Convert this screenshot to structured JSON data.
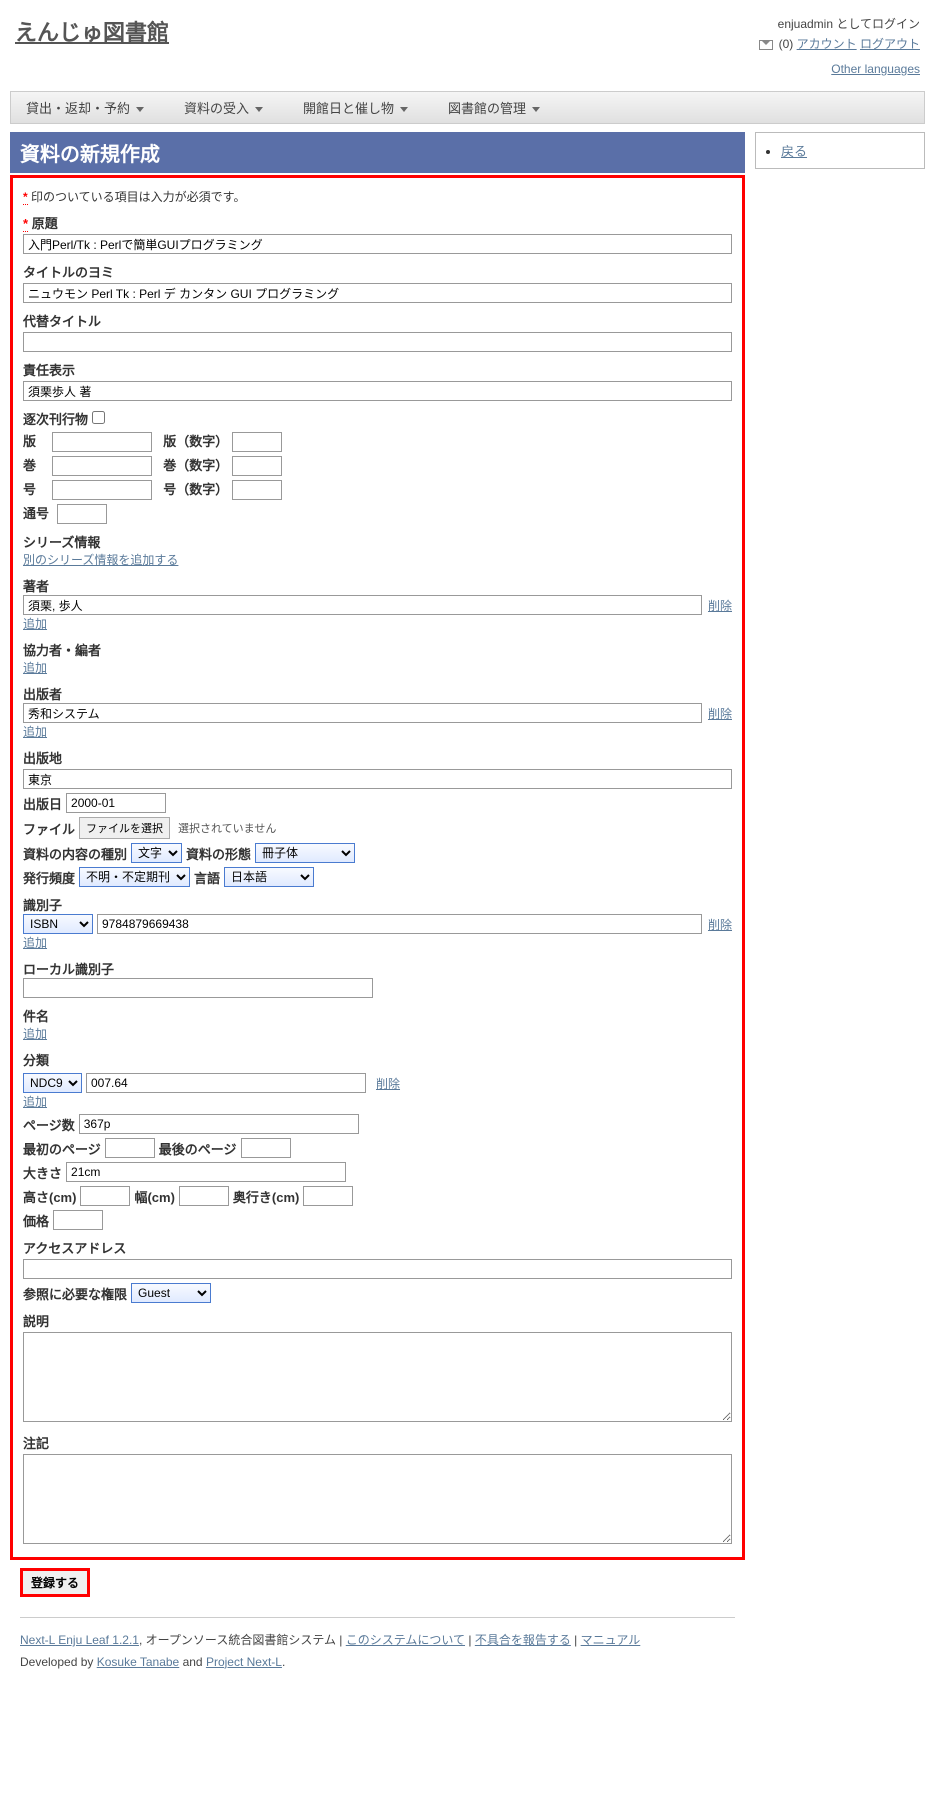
{
  "site_title": "えんじゅ図書館",
  "login_as_prefix": "enjuadmin",
  "login_as_suffix": " としてログイン",
  "msg_count": "(0)",
  "account_link": "アカウント",
  "logout_link": "ログアウト",
  "other_lang": "Other languages",
  "nav": [
    "貸出・返却・予約",
    "資料の受入",
    "開館日と催し物",
    "図書館の管理"
  ],
  "side_back": "戻る",
  "page_title": "資料の新規作成",
  "req_note_prefix": "*",
  "req_note": " 印のついている項目は入力が必須です。",
  "labels": {
    "title": "原題",
    "title_yomi": "タイトルのヨミ",
    "alt_title": "代替タイトル",
    "responsibility": "責任表示",
    "serial": "逐次刊行物",
    "edition": "版",
    "edition_num": "版（数字）",
    "volume": "巻",
    "volume_num": "巻（数字）",
    "issue": "号",
    "issue_num": "号（数字）",
    "serial_num": "通号",
    "series_info": "シリーズ情報",
    "add_series": "別のシリーズ情報を追加する",
    "author": "著者",
    "add": "追加",
    "delete": "削除",
    "contributor": "協力者・編者",
    "publisher": "出版者",
    "pub_place": "出版地",
    "pub_date": "出版日",
    "file": "ファイル",
    "file_btn": "ファイルを選択",
    "file_none": "選択されていません",
    "content_type": "資料の内容の種別",
    "carrier_type": "資料の形態",
    "frequency": "発行頻度",
    "language": "言語",
    "identifier": "識別子",
    "local_id": "ローカル識別子",
    "subject": "件名",
    "classification": "分類",
    "pages": "ページ数",
    "first_page": "最初のページ",
    "last_page": "最後のページ",
    "size": "大きさ",
    "height": "高さ(cm)",
    "width": "幅(cm)",
    "depth": "奥行き(cm)",
    "price": "価格",
    "access_addr": "アクセスアドレス",
    "required_role": "参照に必要な権限",
    "description": "説明",
    "note": "注記"
  },
  "values": {
    "title": "入門Perl/Tk : Perlで簡単GUIプログラミング",
    "title_yomi": "ニュウモン Perl Tk : Perl デ カンタン GUI プログラミング",
    "responsibility": "須栗歩人 著",
    "author": "須栗, 歩人",
    "publisher": "秀和システム",
    "pub_place": "東京",
    "pub_date": "2000-01",
    "content_type": "文字",
    "carrier_type": "冊子体",
    "frequency": "不明・不定期刊",
    "language": "日本語",
    "identifier_type": "ISBN",
    "identifier_val": "9784879669438",
    "class_type": "NDC9",
    "class_val": "007.64",
    "pages": "367p",
    "size": "21cm",
    "required_role": "Guest"
  },
  "submit": "登録する",
  "footer": {
    "product": "Next-L Enju Leaf 1.2.1",
    "tagline": ", オープンソース統合図書館システム | ",
    "about": "このシステムについて",
    "report": "不具合を報告する",
    "manual": "マニュアル",
    "dev_prefix": "Developed by ",
    "dev_name": "Kosuke Tanabe",
    "dev_and": " and ",
    "dev_proj": "Project Next-L",
    "dev_suffix": "."
  }
}
